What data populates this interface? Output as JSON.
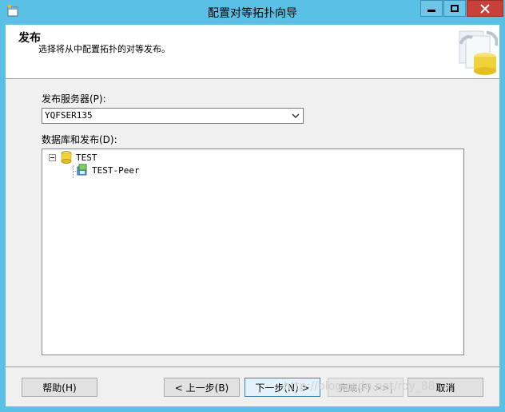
{
  "window": {
    "title": "配置对等拓扑向导"
  },
  "header": {
    "title": "发布",
    "description": "选择将从中配置拓扑的对等发布。"
  },
  "publisher_server": {
    "label": "发布服务器(P):",
    "value": "YQFSER135"
  },
  "databases": {
    "label": "数据库和发布(D):",
    "items": [
      {
        "label": "TEST",
        "icon": "database-icon",
        "children": [
          {
            "label": "TEST-Peer",
            "icon": "publication-icon"
          }
        ]
      }
    ]
  },
  "buttons": {
    "help": "帮助(H)",
    "back": "< 上一步(B)",
    "next": "下一步(N) >",
    "finish": "完成(F) >>|",
    "cancel": "取消"
  },
  "watermark": "http://blog.csdn.net/roy_88"
}
